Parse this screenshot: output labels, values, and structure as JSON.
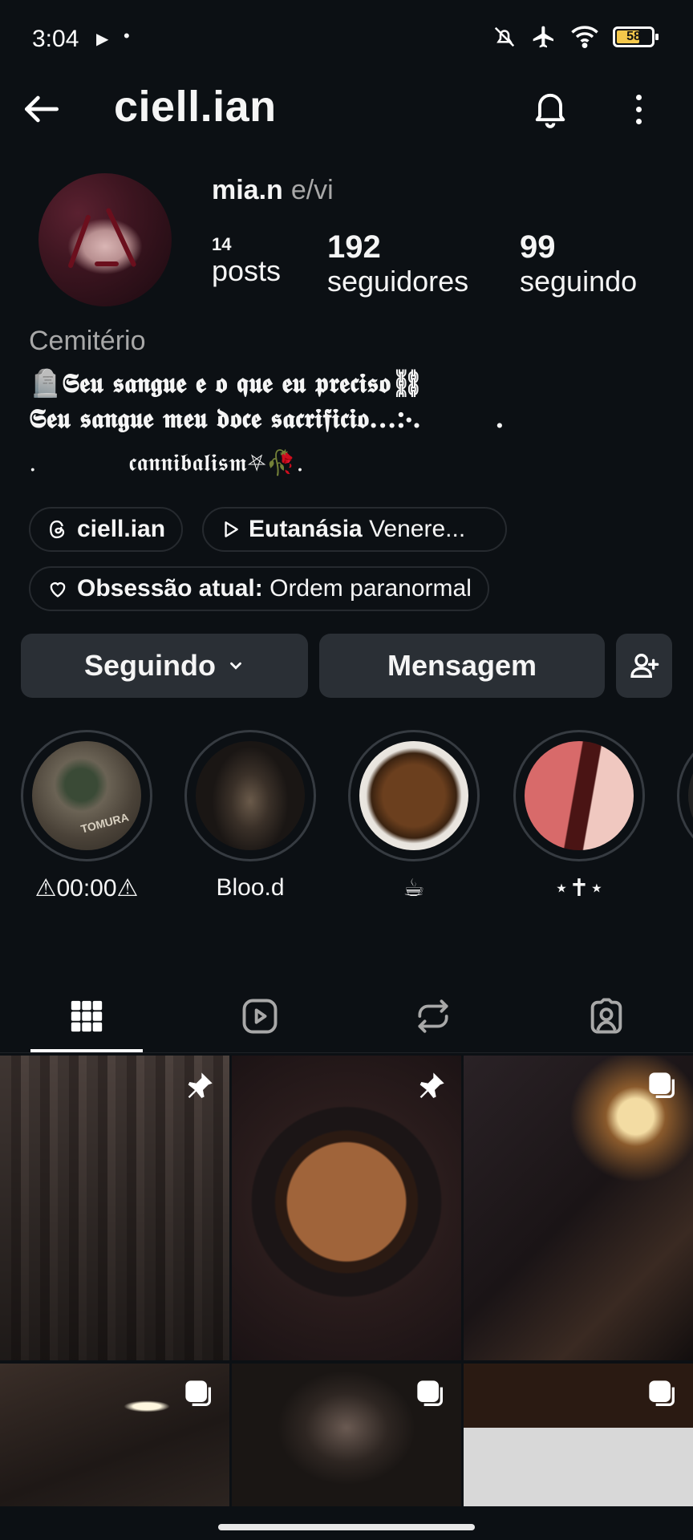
{
  "status_bar": {
    "time": "3:04",
    "battery": "58"
  },
  "header": {
    "username": "ciell.ian"
  },
  "profile": {
    "display_name": "mia.n",
    "pronouns": "e/vi",
    "stats": {
      "posts_count": "14",
      "posts_label": "posts",
      "followers_count": "192",
      "followers_label": "seguidores",
      "following_count": "99",
      "following_label": "seguindo"
    },
    "category": "Cemitério",
    "bio_line1": "🪦𝕾𝖊𝖚 𝖘𝖆𝖓𝖌𝖚𝖊 𝖊 𝖔 𝖖𝖚𝖊 𝖊𝖚 𝖕𝖗𝖊𝖈𝖎𝖘𝖔⛓",
    "bio_line2": "𝕾𝖊𝖚 𝖘𝖆𝖓𝖌𝖚𝖊 𝖒𝖊𝖚 𝖉𝖔𝖈𝖊 𝖘𝖆𝖈𝖗𝖎𝖋𝖎𝖈𝖎𝖔...჻.        .",
    "bio_line3": ".            𝖈𝖆𝖓𝖓𝖎𝖇𝖆𝖑𝖎𝖘𝖒⛧🥀."
  },
  "chips": {
    "threads": "ciell.ian",
    "music_title": "Eutanásia",
    "music_artist": "Venere...",
    "note_label": "Obsessão atual:",
    "note_value": "Ordem paranormal"
  },
  "actions": {
    "following_label": "Seguindo",
    "message_label": "Mensagem"
  },
  "highlights": [
    {
      "label": "⚠00:00⚠",
      "text": "TOMURA"
    },
    {
      "label": "Bloo.d"
    },
    {
      "label": "☕"
    },
    {
      "label": "⋆✝⋆"
    }
  ],
  "icons": {
    "back": "arrow-left-icon",
    "bell": "bell-icon",
    "more": "more-vertical-icon",
    "grid": "grid-icon",
    "reels": "reels-icon",
    "reposts": "repost-icon",
    "tagged": "tagged-icon",
    "pin": "pin-icon",
    "carousel": "carousel-icon"
  },
  "colors": {
    "background": "#0c1014",
    "button": "#2a2f35",
    "muted_text": "#a8a8a8"
  }
}
